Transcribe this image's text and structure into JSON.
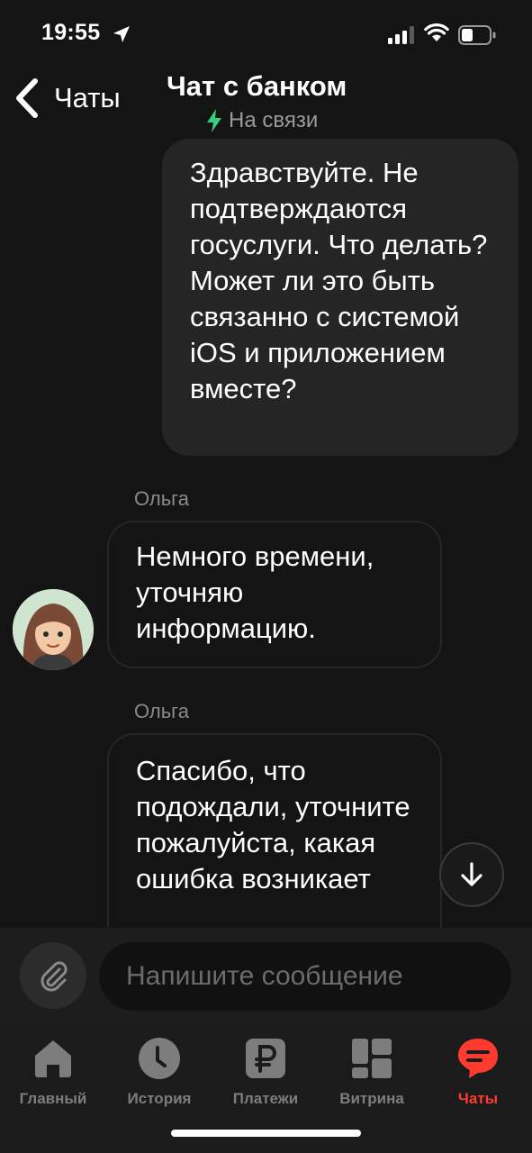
{
  "status_bar": {
    "time": "19:55"
  },
  "header": {
    "back_label": "Чаты",
    "title": "Чат с банком",
    "status": "На связи",
    "status_color": "#35d07f"
  },
  "messages": [
    {
      "from": "user",
      "text": "Здравствуйте. Не подтверждаются госуслуги. Что делать? Может ли это быть связанно с системой iOS и приложением вместе?"
    },
    {
      "from": "operator",
      "sender": "Ольга",
      "text": "Немного времени, уточняю информацию."
    },
    {
      "from": "operator",
      "sender": "Ольга",
      "text": "Спасибо, что подождали, уточните пожалуйста, какая ошибка возникает"
    }
  ],
  "composer": {
    "placeholder": "Напишите сообщение"
  },
  "tabs": [
    {
      "label": "Главный",
      "icon": "home-icon",
      "active": false
    },
    {
      "label": "История",
      "icon": "clock-icon",
      "active": false
    },
    {
      "label": "Платежи",
      "icon": "ruble-icon",
      "active": false
    },
    {
      "label": "Витрина",
      "icon": "grid-icon",
      "active": false
    },
    {
      "label": "Чаты",
      "icon": "chat-icon",
      "active": true
    }
  ],
  "colors": {
    "accent": "#ff3b30",
    "background": "#141414",
    "bubble": "#252525"
  }
}
